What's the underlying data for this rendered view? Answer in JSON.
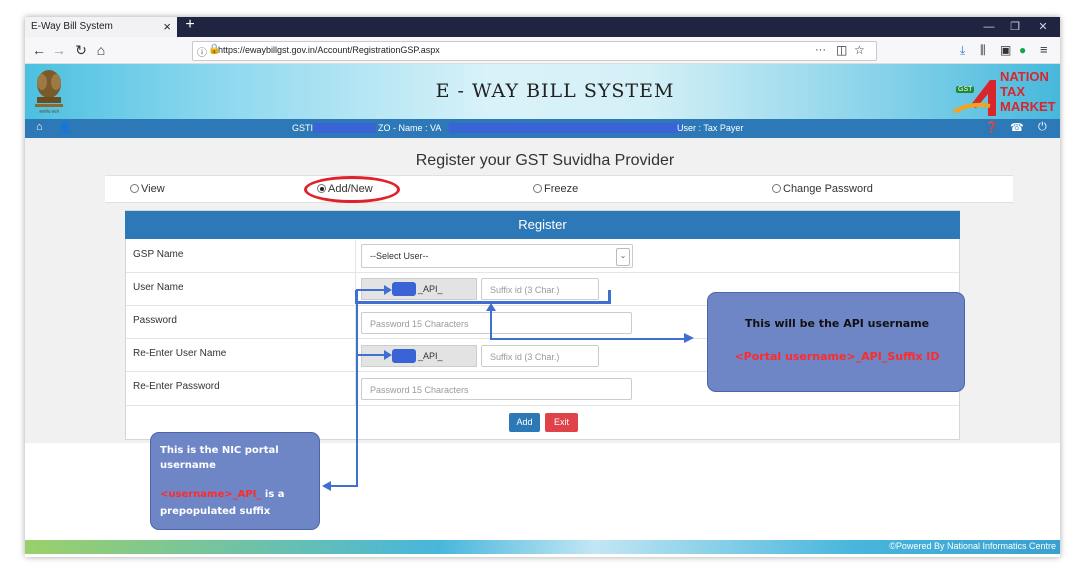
{
  "browser": {
    "tab_title": "E-Way Bill System",
    "tab_close": "×",
    "new_tab": "+",
    "url": "https://ewaybillgst.gov.in/Account/RegistrationGSP.aspx",
    "menu_dots": "···"
  },
  "banner": {
    "title": "E - WAY BILL SYSTEM",
    "logo_line1": "NATION",
    "logo_line2": "TAX",
    "logo_line3": "MARKET",
    "gst_badge": "GST",
    "emblem_caption": "सत्यमेव जयते"
  },
  "userbar": {
    "gstin_label": "GSTI",
    "zo_label": "ZO - Name : VA",
    "user_label": "User : Tax Payer"
  },
  "page": {
    "heading": "Register your GST Suvidha Provider",
    "radios": [
      {
        "label": "View",
        "selected": false
      },
      {
        "label": "Add/New",
        "selected": true
      },
      {
        "label": "Freeze",
        "selected": false
      },
      {
        "label": "Change Password",
        "selected": false
      }
    ]
  },
  "form": {
    "panel_title": "Register",
    "gsp_name_label": "GSP Name",
    "gsp_select_value": "--Select User--",
    "user_name_label": "User Name",
    "api_prefix": "_API_",
    "suffix_placeholder": "Suffix id (3 Char.)",
    "password_label": "Password",
    "password_placeholder": "Password 15 Characters",
    "reenter_user_label": "Re-Enter User Name",
    "reenter_password_label": "Re-Enter Password",
    "add_button": "Add",
    "exit_button": "Exit"
  },
  "callouts": {
    "api_title": "This will be the API username",
    "api_format": "<Portal username>_API_Suffix ID",
    "nic_line1": "This is the NIC portal",
    "nic_line2": "username",
    "nic_red": "<username>_API_",
    "nic_after_red": " is a",
    "nic_line4": "prepopulated suffix"
  },
  "footer": {
    "text": "©Powered By National Informatics Centre"
  },
  "colors": {
    "header_blue": "#2d79b8",
    "add_button": "#2d79b8",
    "exit_button": "#e0424a",
    "callout": "#6f86c6",
    "highlight": "#e0202a"
  }
}
